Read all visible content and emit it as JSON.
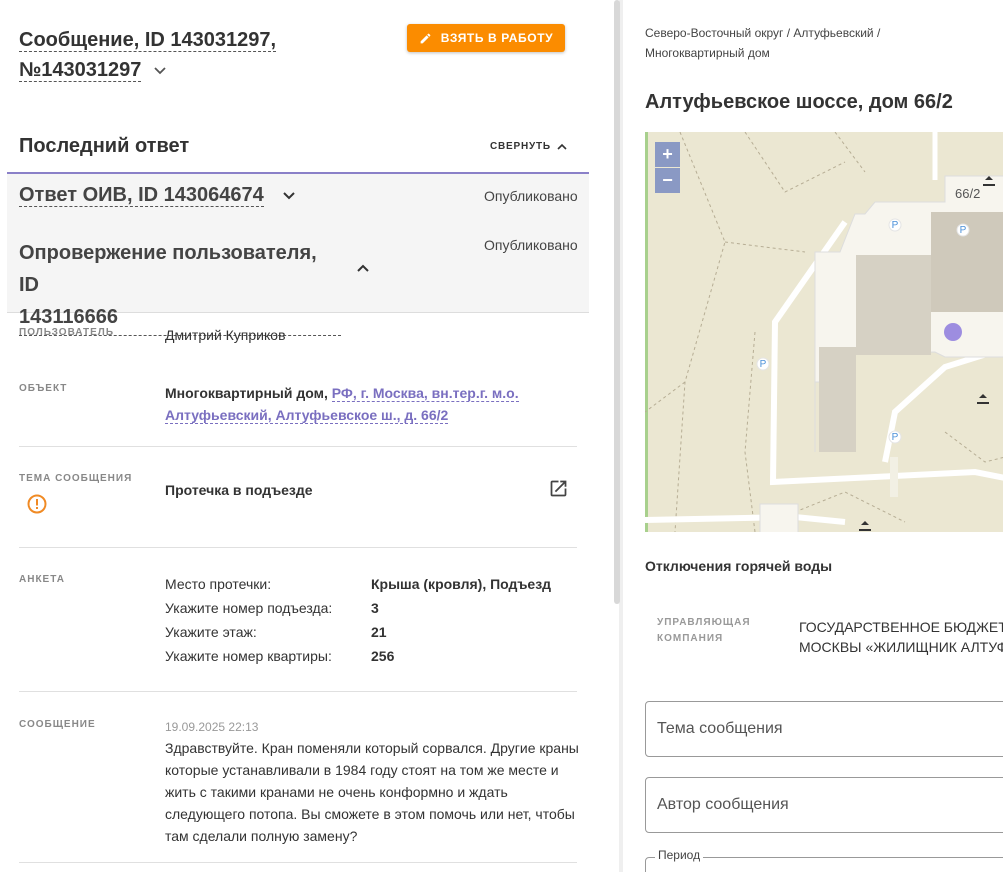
{
  "message": {
    "title_line1": "Сообщение, ID 143031297,",
    "title_line2": "№143031297",
    "take_to_work": "ВЗЯТЬ В РАБОТУ"
  },
  "last_answer": {
    "heading": "Последний ответ",
    "collapse": "СВЕРНУТЬ",
    "answer_title": "Ответ ОИВ, ID 143064674",
    "answer_status": "Опубликовано",
    "refutation_line1": "Опровержение пользователя, ID",
    "refutation_line2": "143116666",
    "refutation_status": "Опубликовано"
  },
  "details": {
    "user_label": "ПОЛЬЗОВАТЕЛЬ",
    "user_value": "Дмитрий Куприков",
    "object_label": "ОБЪЕКТ",
    "object_type": "Многоквартирный дом,",
    "object_link_line1": "РФ, г. Москва, вн.тер.г. м.о.",
    "object_link_line2": "Алтуфьевский, Алтуфьевское ш., д. 66/2",
    "topic_label": "ТЕМА СООБЩЕНИЯ",
    "topic_value": "Протечка в подъезде",
    "form_label": "АНКЕТА",
    "form_rows": [
      {
        "q": "Место протечки:",
        "a": "Крыша (кровля), Подъезд"
      },
      {
        "q": "Укажите номер подъезда:",
        "a": "3"
      },
      {
        "q": "Укажите этаж:",
        "a": "21"
      },
      {
        "q": "Укажите номер квартиры:",
        "a": "256"
      }
    ],
    "message_label": "СООБЩЕНИЕ",
    "message_date": "19.09.2025 22:13",
    "message_lines": [
      "Здравствуйте. Кран поменяли который сорвался. Другие краны",
      "которые устанавливали в 1984 году стоят на том же месте и",
      "жить с такими кранами не очень конформно и ждать",
      "следующего потопа. Вы сможете в этом помочь или нет, чтобы",
      "там сделали полную замену?"
    ]
  },
  "right": {
    "breadcrumb_line1": "Северо-Восточный округ / Алтуфьевский /",
    "breadcrumb_line2": "Многоквартирный дом",
    "address": "Алтуфьевское шоссе, дом 66/2",
    "map_house_number": "66/2",
    "map_zoom_in": "+",
    "map_zoom_out": "−",
    "hot_water": "Отключения горячей воды",
    "uk_label": "УПРАВЛЯЮЩАЯ КОМПАНИЯ",
    "uk_value_line1": "ГОСУДАРСТВЕННОЕ БЮДЖЕТНО",
    "uk_value_line2": "МОСКВЫ «ЖИЛИЩНИК АЛТУФЬ",
    "field_topic": "Тема сообщения",
    "field_author": "Автор сообщения",
    "field_period": "Период"
  },
  "colors": {
    "accent_orange": "#fb8c00",
    "accent_purple": "#7a6fc0",
    "map_bg": "#ebe7d2"
  }
}
